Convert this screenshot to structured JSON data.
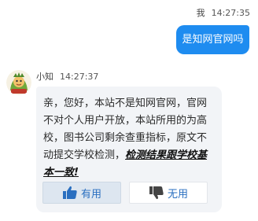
{
  "user_message": {
    "sender": "我",
    "time": "14:27:35",
    "text": "是知网官网吗"
  },
  "bot_message": {
    "sender": "小知",
    "time": "14:27:37",
    "text_plain": "亲，您好，本站不是知网官网，官网不对个人用户开放，本站所用的为高校，图书公司剩余查重指标，原文不动提交学校检测，",
    "text_emphasis": "检测结果跟学校基本一致!"
  },
  "feedback": {
    "like_label": "有用",
    "dislike_label": "无用"
  },
  "colors": {
    "user_bubble": "#1e8cf0",
    "bot_bubble": "#f2f4f7",
    "accent_text": "#2a6fc0"
  }
}
